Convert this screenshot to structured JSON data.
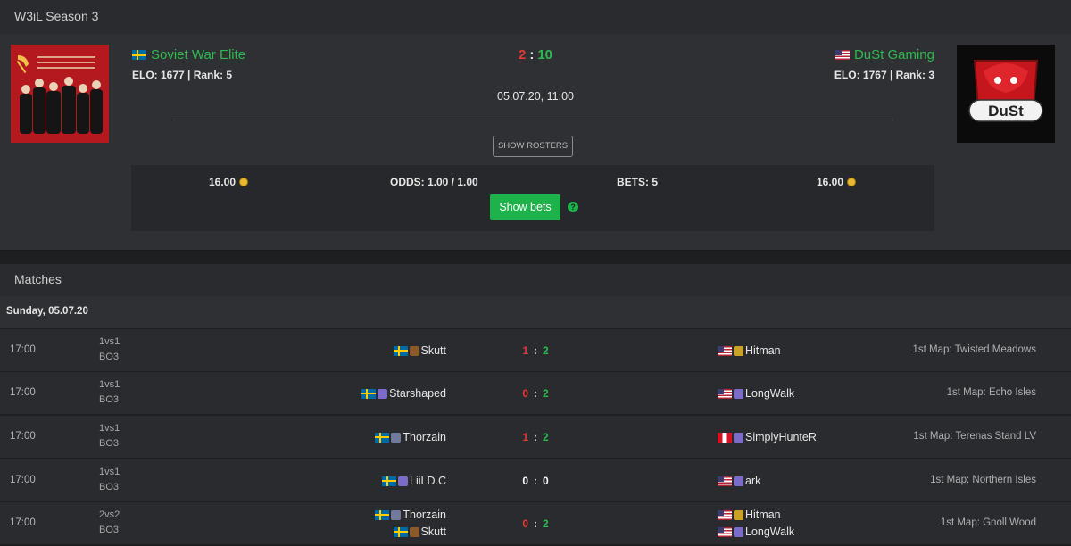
{
  "season": {
    "title": "W3iL Season 3"
  },
  "match": {
    "team_left": {
      "name": "Soviet War Elite",
      "elo_line": "ELO: 1677 | Rank: 5",
      "flag": "flag-se"
    },
    "team_right": {
      "name": "DuSt Gaming",
      "elo_line": "ELO: 1767 | Rank: 3",
      "flag": "flag-us"
    },
    "score_left": "2",
    "score_sep": ":",
    "score_right": "10",
    "datetime": "05.07.20, 11:00",
    "rosters_label": "SHOW ROSTERS",
    "logo_right_text": "DuSt"
  },
  "bets": {
    "left_amount": "16.00",
    "odds": "ODDS: 1.00 / 1.00",
    "count": "BETS: 5",
    "right_amount": "16.00",
    "button_label": "Show bets",
    "help_glyph": "?",
    "colors": {
      "button": "#1eb34a",
      "coin": "#e8b830"
    }
  },
  "matches": {
    "title": "Matches",
    "day_label": "Sunday, 05.07.20",
    "rows": [
      {
        "time": "17:00",
        "format_top": "1vs1",
        "format_bottom": "BO3",
        "p1": [
          {
            "flag": "se",
            "race": "orc",
            "name": "Skutt"
          }
        ],
        "p2": [
          {
            "flag": "us",
            "race": "hu",
            "name": "Hitman"
          }
        ],
        "s1": "1",
        "s2": "2",
        "map": "1st Map: Twisted Meadows"
      },
      {
        "time": "17:00",
        "format_top": "1vs1",
        "format_bottom": "BO3",
        "p1": [
          {
            "flag": "se",
            "race": "ne",
            "name": "Starshaped"
          }
        ],
        "p2": [
          {
            "flag": "us",
            "race": "ne",
            "name": "LongWalk"
          }
        ],
        "s1": "0",
        "s2": "2",
        "map": "1st Map: Echo Isles"
      },
      {
        "time": "17:00",
        "format_top": "1vs1",
        "format_bottom": "BO3",
        "p1": [
          {
            "flag": "se",
            "race": "ud",
            "name": "Thorzain"
          }
        ],
        "p2": [
          {
            "flag": "pe",
            "race": "ne",
            "name": "SimplyHunteR"
          }
        ],
        "s1": "1",
        "s2": "2",
        "map": "1st Map: Terenas Stand LV"
      },
      {
        "time": "17:00",
        "format_top": "1vs1",
        "format_bottom": "BO3",
        "p1": [
          {
            "flag": "se",
            "race": "ne",
            "name": "LiiLD.C"
          }
        ],
        "p2": [
          {
            "flag": "us",
            "race": "ne",
            "name": "ark"
          }
        ],
        "s1": "0",
        "s2": "0",
        "map": "1st Map: Northern Isles"
      },
      {
        "time": "17:00",
        "format_top": "2vs2",
        "format_bottom": "BO3",
        "p1": [
          {
            "flag": "se",
            "race": "ud",
            "name": "Thorzain"
          },
          {
            "flag": "se",
            "race": "orc",
            "name": "Skutt"
          }
        ],
        "p2": [
          {
            "flag": "us",
            "race": "hu",
            "name": "Hitman"
          },
          {
            "flag": "us",
            "race": "ne",
            "name": "LongWalk"
          }
        ],
        "s1": "0",
        "s2": "2",
        "map": "1st Map: Gnoll Wood"
      }
    ]
  }
}
